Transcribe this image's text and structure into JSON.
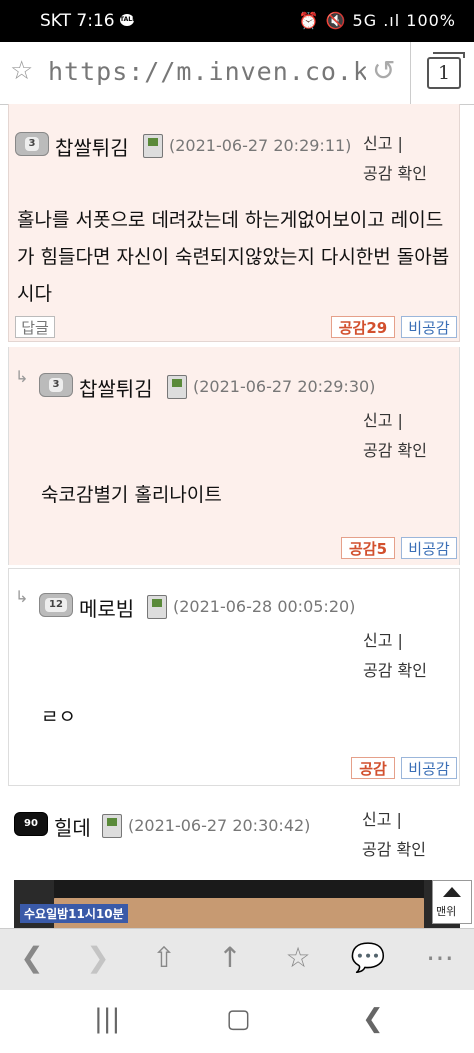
{
  "status": {
    "carrier": "SKT",
    "time": "7:16",
    "talk_badge": "TALK",
    "indicators": "⏰ 🔇 5G .ıl 100%"
  },
  "browser": {
    "url": "https://m.inven.co.kr/b...",
    "tab_count": "1"
  },
  "comments": [
    {
      "level": "3",
      "nick": "찹쌀튀김",
      "date": "(2021-06-27 20:29:11)",
      "report": "신고 |",
      "empathy_check": "공감 확인",
      "body": "홀나를 서폿으로 데려갔는데 하는게없어보이고 레이드가 힘들다면 자신이 숙련되지않았는지 다시한번 돌아봅시다",
      "reply_label": "답글",
      "like_label": "공감29",
      "dislike_label": "비공감"
    },
    {
      "level": "3",
      "nick": "찹쌀튀김",
      "date": "(2021-06-27 20:29:30)",
      "report": "신고 |",
      "empathy_check": "공감 확인",
      "body": "숙코감별기 홀리나이트",
      "like_label": "공감5",
      "dislike_label": "비공감"
    },
    {
      "level": "12",
      "nick": "메로빔",
      "date": "(2021-06-28 00:05:20)",
      "report": "신고 |",
      "empathy_check": "공감 확인",
      "body": "ㄹㅇ",
      "like_label": "공감",
      "dislike_label": "비공감"
    },
    {
      "level": "90",
      "nick": "힐데",
      "date": "(2021-06-27 20:30:42)",
      "report": "신고 |",
      "empathy_check": "공감 확인",
      "image_caption": "수요일밤11시10분"
    }
  ],
  "scroll_top_label": "맨위",
  "icons": {
    "browser_bar": [
      "back-icon",
      "forward-icon",
      "home-icon",
      "up-icon",
      "bookmark-icon",
      "chat-icon",
      "more-icon"
    ],
    "nav_bar": [
      "recent-apps-icon",
      "home-button-icon",
      "back-button-icon"
    ]
  }
}
